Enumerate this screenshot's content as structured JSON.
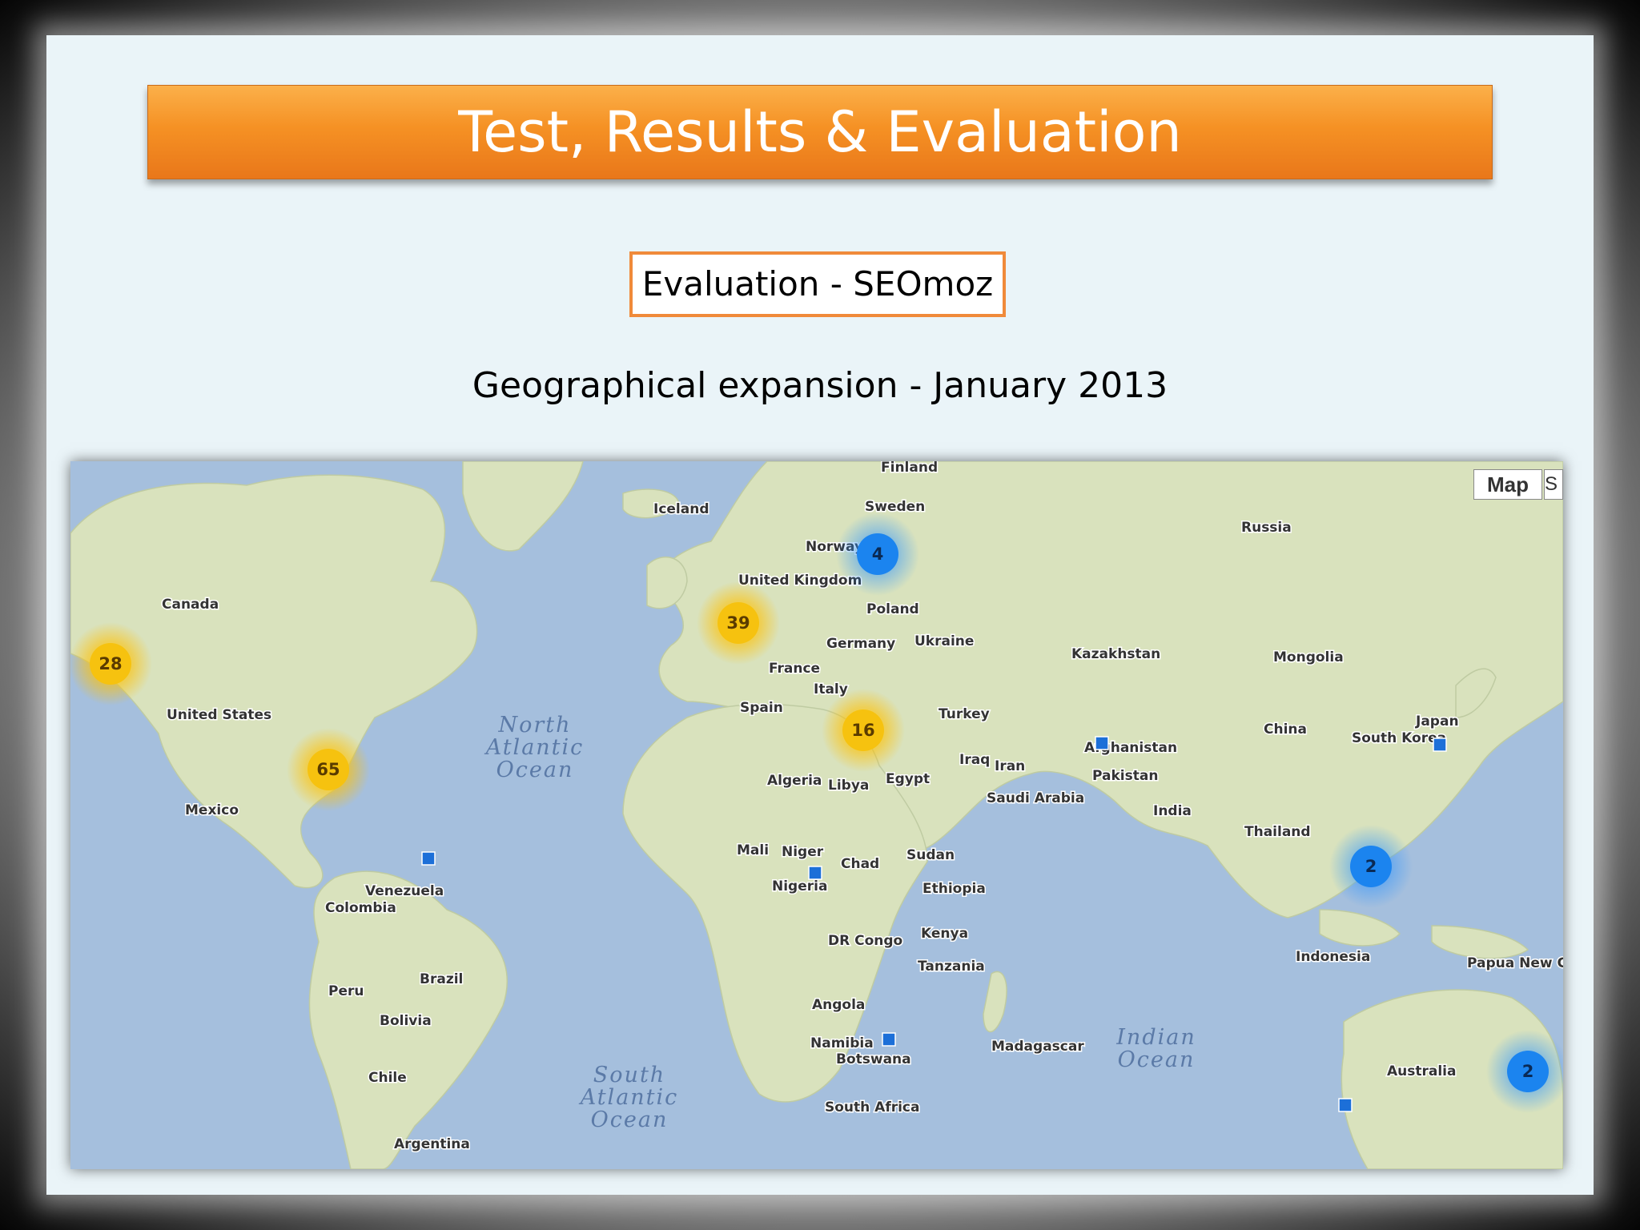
{
  "slide": {
    "title": "Test, Results & Evaluation",
    "subtitle": "Evaluation - SEOmoz",
    "caption": "Geographical expansion - January 2013"
  },
  "map": {
    "map_type_button": "Map",
    "map_type_button_2": "S",
    "colors": {
      "ocean": "#a5bfdd",
      "land": "#d9e2bd",
      "cluster_yellow": "#f6c20f",
      "cluster_blue": "#1b84ef",
      "marker_blue": "#1c6fd8"
    },
    "countries": [
      "Finland",
      "Sweden",
      "Iceland",
      "Norway",
      "Russia",
      "United Kingdom",
      "Poland",
      "Canada",
      "Germany",
      "Ukraine",
      "Kazakhstan",
      "Mongolia",
      "France",
      "Italy",
      "Turkey",
      "United States",
      "Spain",
      "Afghanistan",
      "China",
      "South Korea",
      "Japan",
      "Iraq",
      "Iran",
      "Pakistan",
      "Algeria",
      "Libya",
      "Egypt",
      "Saudi Arabia",
      "India",
      "Mexico",
      "Thailand",
      "Mali",
      "Niger",
      "Chad",
      "Sudan",
      "Nigeria",
      "Venezuela",
      "Ethiopia",
      "Colombia",
      "Kenya",
      "DR Congo",
      "Tanzania",
      "Indonesia",
      "Papua New Guinea",
      "Brazil",
      "Peru",
      "Angola",
      "Bolivia",
      "Namibia",
      "Botswana",
      "Madagascar",
      "Australia",
      "Chile",
      "South Africa",
      "Argentina"
    ],
    "oceans": [
      [
        "North",
        "Atlantic",
        "Ocean"
      ],
      [
        "South",
        "Atlantic",
        "Ocean"
      ],
      [
        "Indian",
        "Ocean"
      ]
    ],
    "clusters": [
      {
        "label": "28",
        "color": "yellow",
        "location": "US West Coast"
      },
      {
        "label": "65",
        "color": "yellow",
        "location": "US East Coast"
      },
      {
        "label": "39",
        "color": "yellow",
        "location": "United Kingdom"
      },
      {
        "label": "16",
        "color": "yellow",
        "location": "Greece"
      },
      {
        "label": "4",
        "color": "blue",
        "location": "Baltic"
      },
      {
        "label": "2",
        "color": "blue",
        "location": "Philippines"
      },
      {
        "label": "2",
        "color": "blue",
        "location": "Eastern Australia"
      }
    ],
    "single_markers": [
      "Caribbean",
      "Chad",
      "Afghanistan",
      "South Korea",
      "Botswana",
      "Western Australia"
    ]
  }
}
